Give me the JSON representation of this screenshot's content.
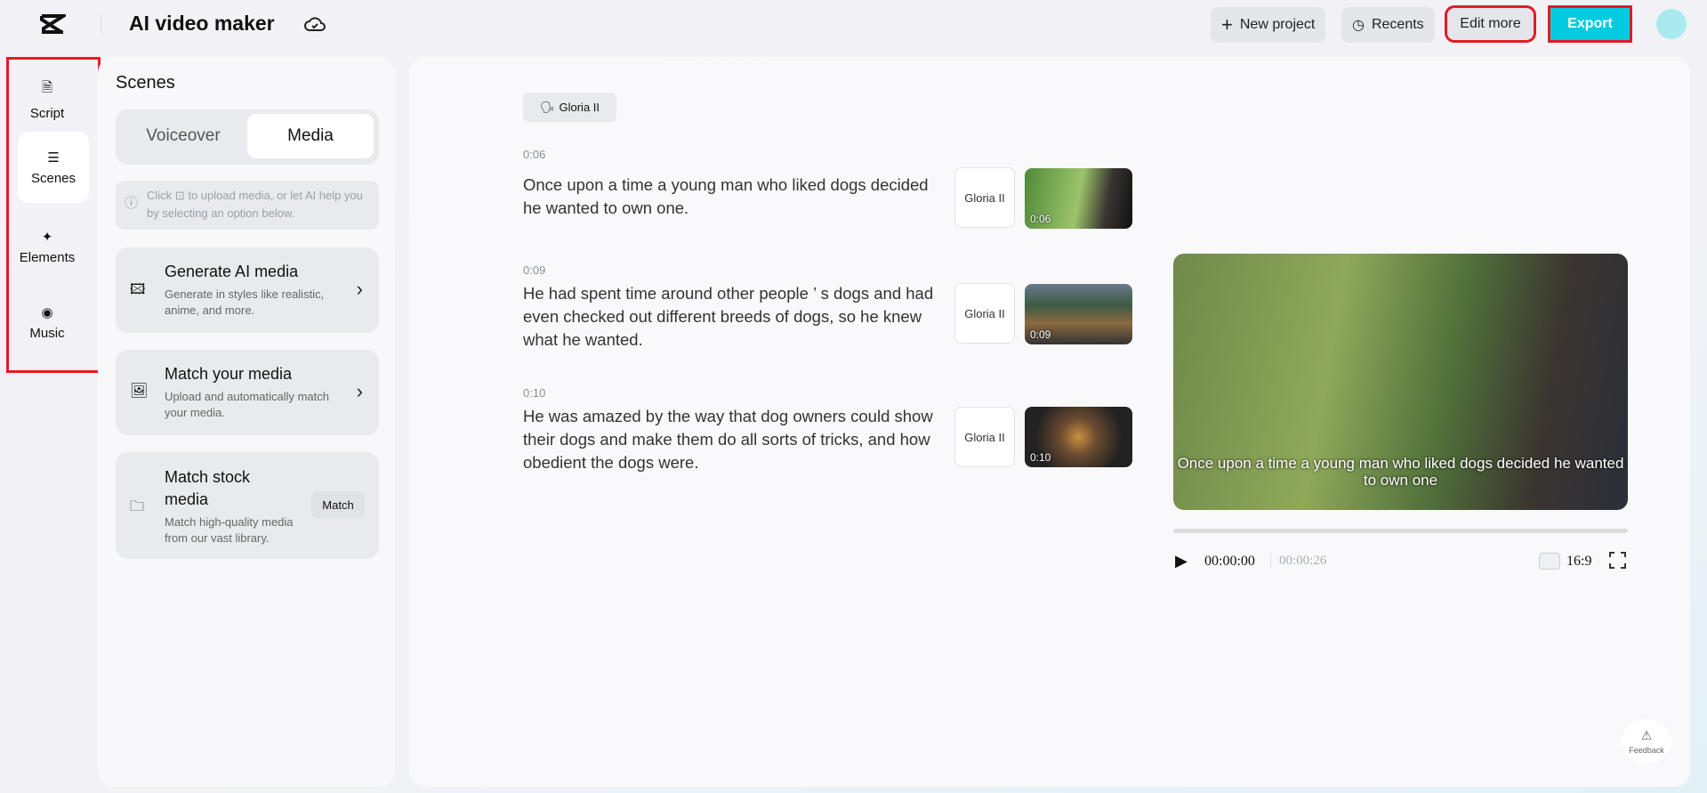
{
  "header": {
    "title": "AI video maker",
    "new_project": "New project",
    "recents": "Recents",
    "edit_more": "Edit more",
    "export": "Export"
  },
  "rail": [
    {
      "label": "Script",
      "icon": "script-icon"
    },
    {
      "label": "Scenes",
      "icon": "scenes-icon"
    },
    {
      "label": "Elements",
      "icon": "elements-icon"
    },
    {
      "label": "Music",
      "icon": "music-icon"
    }
  ],
  "panel": {
    "title": "Scenes",
    "tabs": [
      "Voiceover",
      "Media"
    ],
    "active_tab": "Media",
    "info_pre": "Click",
    "info_post": "to upload media, or let AI help you by selecting an option below.",
    "cards": [
      {
        "title": "Generate AI media",
        "desc": "Generate in styles like realistic, anime, and more."
      },
      {
        "title": "Match your media",
        "desc": "Upload and automatically match your media."
      },
      {
        "title": "Match stock media",
        "desc": "Match high-quality media from our vast library.",
        "button": "Match"
      }
    ]
  },
  "voice_chip": "Gloria II",
  "scenes": [
    {
      "time": "0:06",
      "text": "Once upon a time a young man who liked dogs decided he wanted to own one.",
      "voice": "Gloria II",
      "thumb_time": "0:06"
    },
    {
      "time": "0:09",
      "text": "He had spent time around other people ’ s dogs and had even checked out different breeds of dogs, so he knew what he wanted.",
      "voice": "Gloria II",
      "thumb_time": "0:09"
    },
    {
      "time": "0:10",
      "text": "He was amazed by the way that dog owners could show their dogs and make them do all sorts of tricks, and how obedient the dogs were.",
      "voice": "Gloria II",
      "thumb_time": "0:10"
    }
  ],
  "player": {
    "subtitle": "Once upon a time a young man who liked dogs decided he wanted to own one",
    "current": "00:00:00",
    "total": "00:00:26",
    "ratio": "16:9",
    "progress": 0
  },
  "feedback": "Feedback",
  "colors": {
    "accent": "#00cbe0",
    "highlight": "#e31b23"
  }
}
